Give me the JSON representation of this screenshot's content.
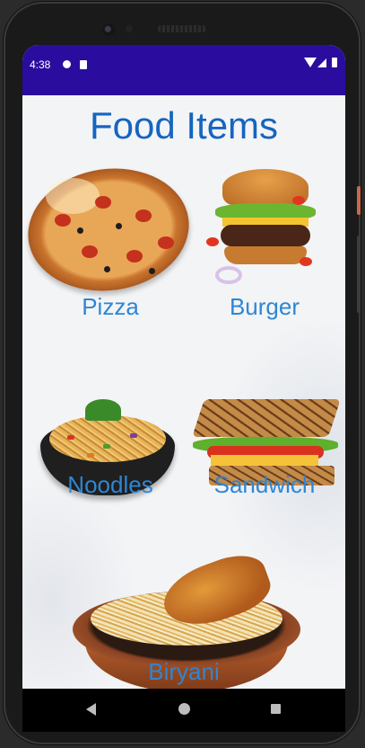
{
  "status_bar": {
    "time": "4:38"
  },
  "page": {
    "title": "Food Items"
  },
  "foods": [
    {
      "name": "Pizza",
      "icon": "pizza-image"
    },
    {
      "name": "Burger",
      "icon": "burger-image"
    },
    {
      "name": "Noodles",
      "icon": "noodles-image"
    },
    {
      "name": "Sandwich",
      "icon": "sandwich-image"
    },
    {
      "name": "Biryani",
      "icon": "biryani-image"
    }
  ],
  "colors": {
    "status_bar": "#2a0d9e",
    "title": "#1565c0",
    "label": "#2e86d4"
  }
}
